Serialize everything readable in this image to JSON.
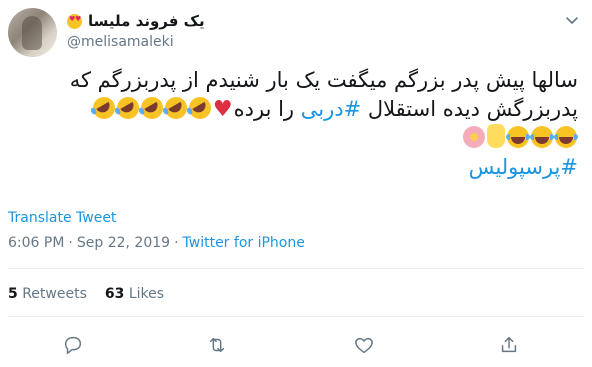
{
  "user": {
    "display_name": "یک فروند ملیسا",
    "display_emoji": "smiling-face-with-heart-eyes",
    "handle": "@melisamaleki"
  },
  "tweet": {
    "line1": "سالها پیش پدر بزرگم میگفت یک بار شنیدم از پدربزرگم که",
    "line2_prefix": "پدربزرگش دیده استقلال",
    "line2_hashtag": "#دربی",
    "line2_suffix": "را برده",
    "line4_hashtag": "#پرسپولیس",
    "translate_label": "Translate Tweet",
    "time": "6:06 PM",
    "date": "Sep 22, 2019",
    "source": "Twitter for iPhone"
  },
  "stats": {
    "retweets_count": "5",
    "retweets_label": "Retweets",
    "likes_count": "63",
    "likes_label": "Likes"
  },
  "icons": {
    "line2_emojis": [
      "red-heart",
      "rofl",
      "rofl",
      "rofl",
      "rofl",
      "rofl"
    ],
    "line3_emojis": [
      "joy",
      "joy",
      "joy",
      "raised-hand",
      "cherry-blossom"
    ]
  },
  "colors": {
    "link": "#1b95e0",
    "muted": "#657786",
    "text": "#14171a"
  }
}
